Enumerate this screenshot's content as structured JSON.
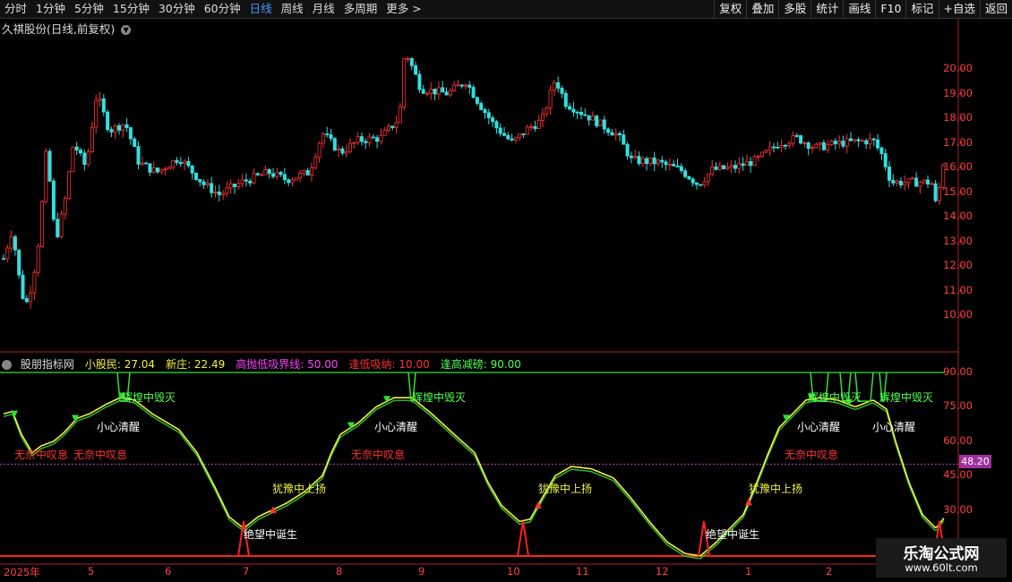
{
  "toolbar": {
    "periods": [
      "分时",
      "1分钟",
      "5分钟",
      "15分钟",
      "30分钟",
      "60分钟",
      "日线",
      "周线",
      "月线",
      "多周期",
      "更多 >"
    ],
    "active_period": "日线",
    "tools": [
      "复权",
      "叠加",
      "多股",
      "统计",
      "画线",
      "F10",
      "标记",
      "+自选",
      "返回"
    ]
  },
  "stock": {
    "title": "久祺股份(日线,前复权)"
  },
  "price_axis": [
    "20.00",
    "19.00",
    "18.00",
    "17.00",
    "16.00",
    "15.00",
    "14.00",
    "13.00",
    "12.00",
    "11.00",
    "10.00"
  ],
  "indicator": {
    "name": "股朋指标网",
    "items": [
      {
        "label": "小股民: 27.04",
        "color": "#f0f040"
      },
      {
        "label": "新庄: 22.49",
        "color": "#f0f040"
      },
      {
        "label": "高抛低吸界线: 50.00",
        "color": "#ff40ff"
      },
      {
        "label": "逢低吸纳: 10.00",
        "color": "#ff3030"
      },
      {
        "label": "逢高减磅: 90.00",
        "color": "#50ff50"
      }
    ],
    "axis": [
      "90.00",
      "75.00",
      "60.00",
      "45.00",
      "30.00"
    ],
    "marker": "48.20"
  },
  "signals": {
    "s1": "无奈中叹息",
    "s2": "无奈中叹息",
    "s3": "无奈中叹息",
    "s4": "无奈中叹息",
    "c1": "小心清醒",
    "c2": "小心清醒",
    "c3": "小心清醒",
    "c4": "小心清醒",
    "d1": "绝望中诞生",
    "d2": "绝望中诞生",
    "y1": "犹豫中上扬",
    "y2": "犹豫中上扬",
    "y3": "犹豫中上扬",
    "h1": "辉煌中毁灭",
    "h2": "辉煌中毁灭",
    "h3": "辉煌中毁灭",
    "h4": "辉煌中毁灭"
  },
  "time_axis": [
    "2025年",
    "5",
    "6",
    "7",
    "8",
    "9",
    "10",
    "11",
    "12",
    "1",
    "2"
  ],
  "watermark": {
    "name": "乐淘公式网",
    "url": "www.60lt.com"
  },
  "colors": {
    "up": "#ff3030",
    "down": "#30e0e0",
    "line": "#f0f040"
  }
}
